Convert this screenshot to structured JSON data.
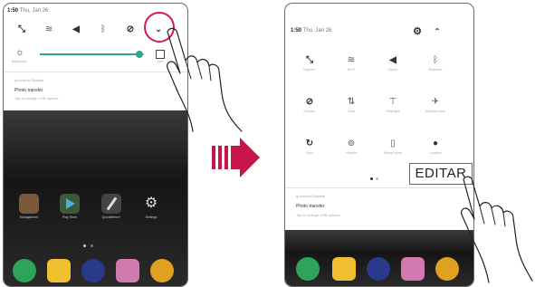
{
  "left_phone": {
    "status": {
      "time": "1:50",
      "date": "Thu, Jan 26"
    },
    "brightness": {
      "label": "Brightness",
      "level": 0.95,
      "auto_label": "Auto"
    },
    "notification": {
      "app": "Android System",
      "title": "Photo transfer",
      "subtitle": "Tap to change USB options"
    },
    "apps": [
      {
        "label": "Management",
        "icon": "folder-icon"
      },
      {
        "label": "Play Store",
        "icon": "play-store-icon"
      },
      {
        "label": "QuickMemo+",
        "icon": "pen-icon"
      },
      {
        "label": "Settings",
        "icon": "gear-icon"
      }
    ],
    "dock": [
      "phone-icon",
      "messages-icon",
      "camera-icon",
      "gallery-icon",
      "chrome-icon"
    ]
  },
  "right_phone": {
    "status": {
      "time": "1:50",
      "date": "Thu, Jan 26"
    },
    "tiles": [
      {
        "label": "Capture+",
        "icon": "capture-icon"
      },
      {
        "label": "Wi-Fi",
        "icon": "wifi-icon"
      },
      {
        "label": "Sound",
        "icon": "sound-icon"
      },
      {
        "label": "Bluetooth",
        "icon": "bluetooth-icon"
      },
      {
        "label": "Rotation",
        "icon": "rotation-icon"
      },
      {
        "label": "Data",
        "icon": "data-icon"
      },
      {
        "label": "Flashlight",
        "icon": "flashlight-icon"
      },
      {
        "label": "Airplane mode",
        "icon": "airplane-icon"
      },
      {
        "label": "Sync",
        "icon": "sync-icon"
      },
      {
        "label": "Hotspot",
        "icon": "hotspot-icon"
      },
      {
        "label": "Battery saver",
        "icon": "battery-saver-icon"
      },
      {
        "label": "Location",
        "icon": "location-icon"
      }
    ],
    "notification": {
      "app": "Android System",
      "title": "Photo transfer",
      "subtitle": "Tap to change USB options"
    },
    "dock": [
      "phone-icon",
      "messages-icon",
      "camera-icon",
      "gallery-icon",
      "chrome-icon"
    ]
  },
  "callout": {
    "label": "EDITAR"
  },
  "colors": {
    "arrow": "#c8164a",
    "highlight_circle": "#d6184c",
    "slider": "#2fa68a"
  }
}
